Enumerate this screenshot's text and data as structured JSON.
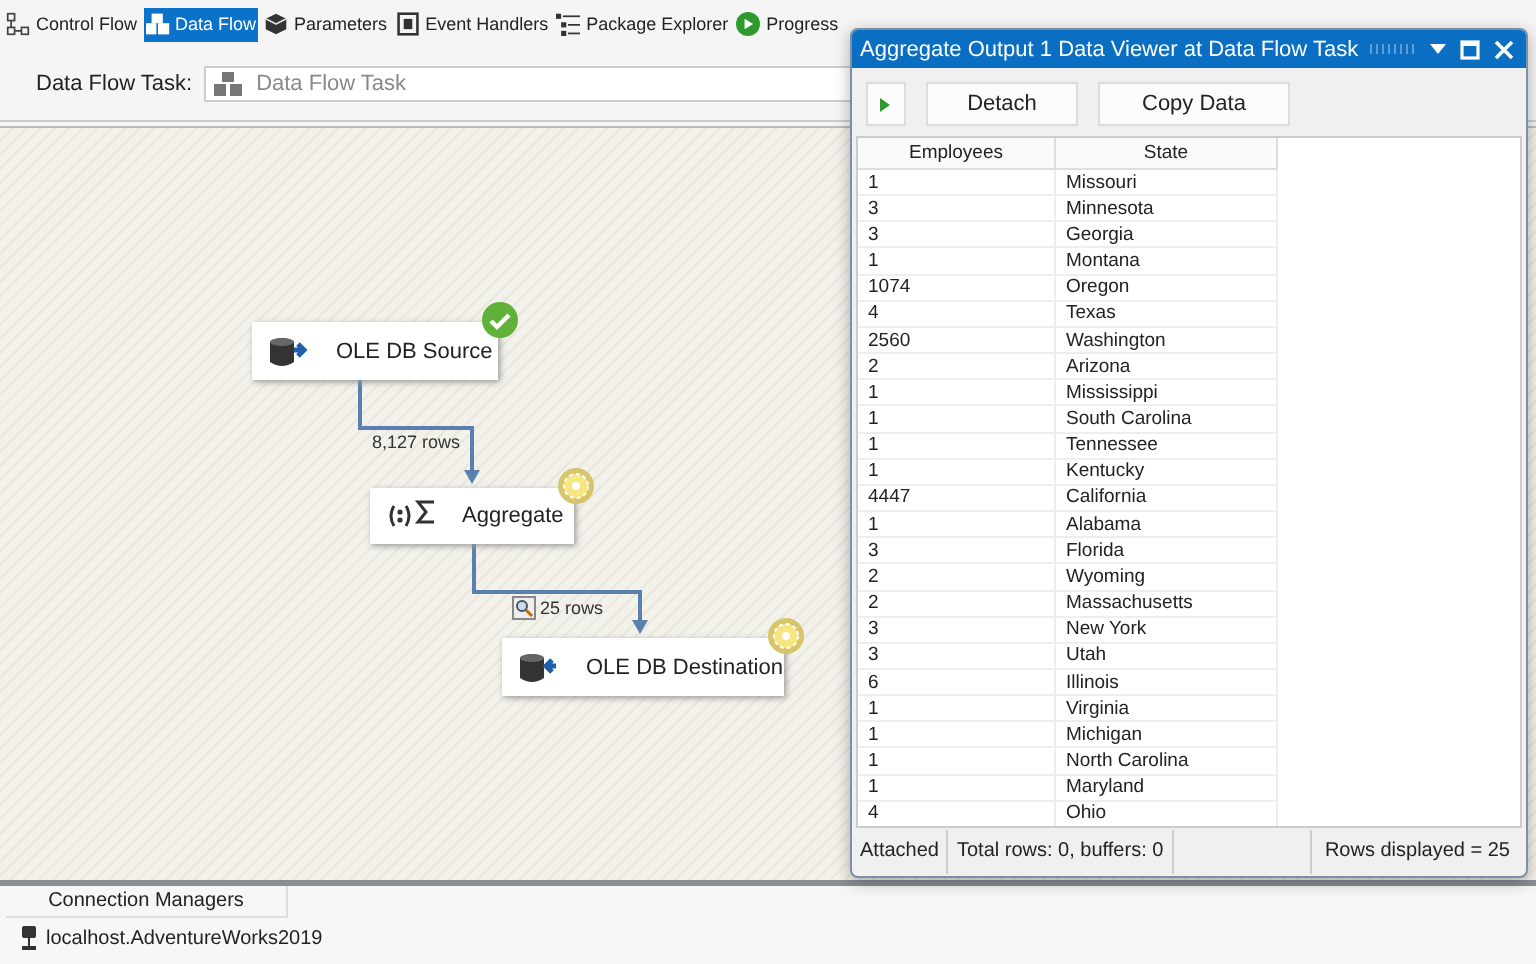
{
  "tabs": [
    {
      "label": "Control Flow",
      "selected": false
    },
    {
      "label": "Data Flow",
      "selected": true
    },
    {
      "label": "Parameters",
      "selected": false
    },
    {
      "label": "Event Handlers",
      "selected": false
    },
    {
      "label": "Package Explorer",
      "selected": false
    },
    {
      "label": "Progress",
      "selected": false
    }
  ],
  "task_bar": {
    "label": "Data Flow Task:",
    "value": "Data Flow Task"
  },
  "canvas": {
    "nodes": [
      {
        "label": "OLE DB Source",
        "kind": "source",
        "succeeded": true
      },
      {
        "label": "Aggregate",
        "kind": "aggregate",
        "succeeded": false
      },
      {
        "label": "OLE DB Destination",
        "kind": "destination",
        "succeeded": false
      }
    ],
    "paths": [
      {
        "label": "8,127 rows",
        "viewer": false
      },
      {
        "label": "25 rows",
        "viewer": true
      }
    ]
  },
  "data_viewer": {
    "title": "Aggregate Output 1 Data Viewer at Data Flow Task",
    "buttons": [
      "Detach",
      "Copy Data"
    ],
    "columns": [
      "Employees",
      "State"
    ],
    "rows": [
      [
        "1",
        "Missouri"
      ],
      [
        "3",
        "Minnesota"
      ],
      [
        "3",
        "Georgia"
      ],
      [
        "1",
        "Montana"
      ],
      [
        "1074",
        "Oregon"
      ],
      [
        "4",
        "Texas"
      ],
      [
        "2560",
        "Washington"
      ],
      [
        "2",
        "Arizona"
      ],
      [
        "1",
        "Mississippi"
      ],
      [
        "1",
        "South Carolina"
      ],
      [
        "1",
        "Tennessee"
      ],
      [
        "1",
        "Kentucky"
      ],
      [
        "4447",
        "California"
      ],
      [
        "1",
        "Alabama"
      ],
      [
        "3",
        "Florida"
      ],
      [
        "2",
        "Wyoming"
      ],
      [
        "2",
        "Massachusetts"
      ],
      [
        "3",
        "New York"
      ],
      [
        "3",
        "Utah"
      ],
      [
        "6",
        "Illinois"
      ],
      [
        "1",
        "Virginia"
      ],
      [
        "1",
        "Michigan"
      ],
      [
        "1",
        "North Carolina"
      ],
      [
        "1",
        "Maryland"
      ],
      [
        "4",
        "Ohio"
      ]
    ],
    "status": {
      "state": "Attached",
      "totals": "Total rows: 0, buffers: 0",
      "displayed": "Rows displayed = 25"
    }
  },
  "connection_managers": {
    "tab": "Connection Managers",
    "items": [
      "localhost.AdventureWorks2019"
    ]
  }
}
